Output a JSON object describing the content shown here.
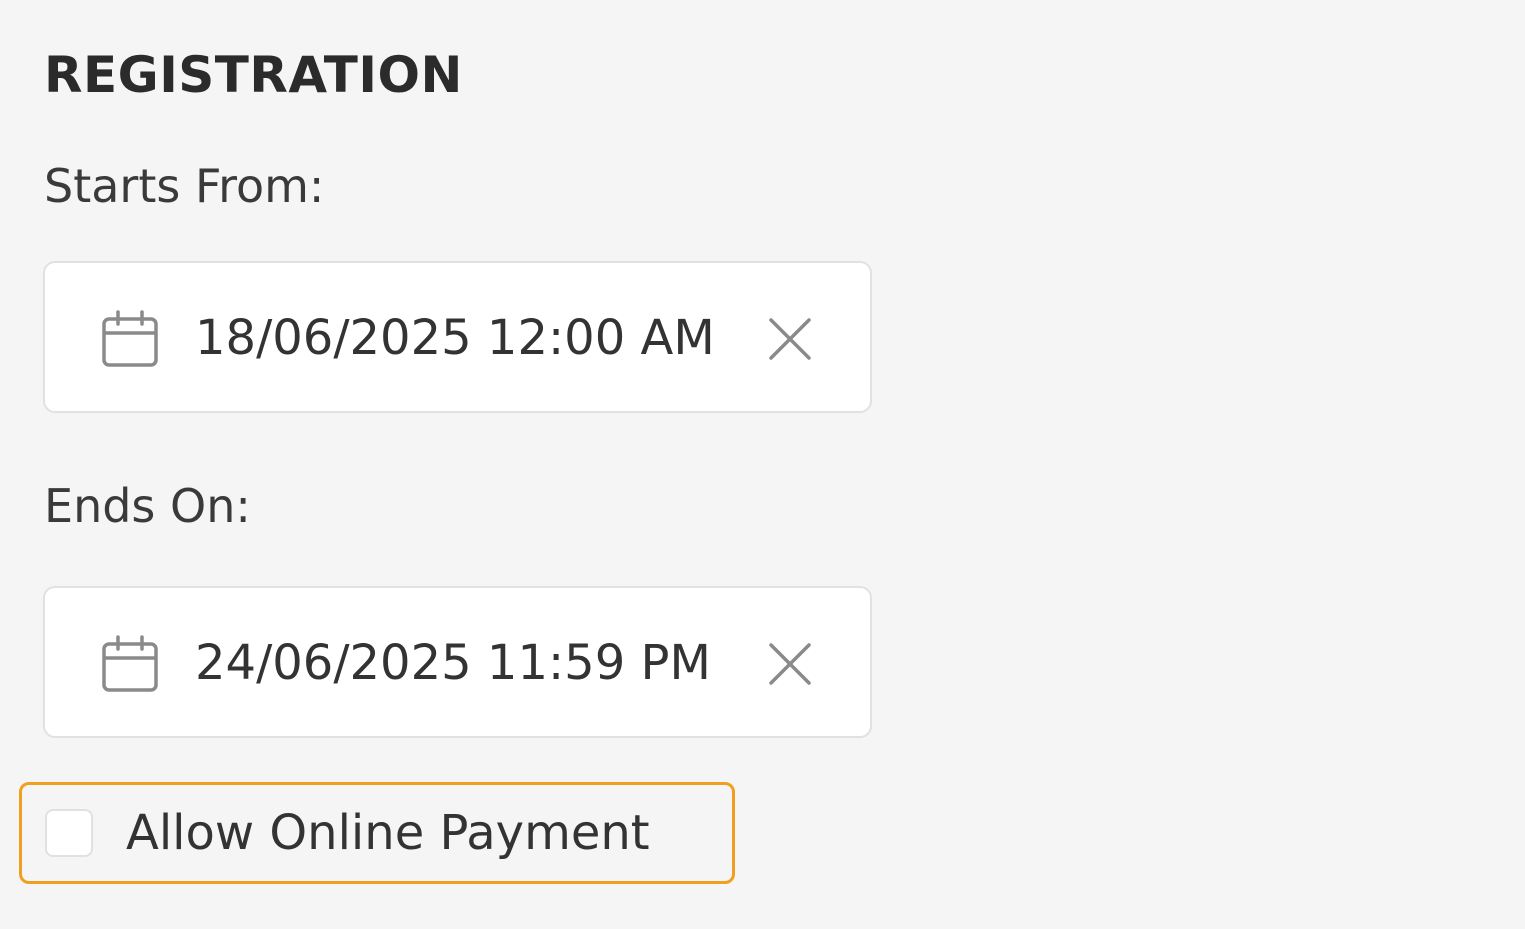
{
  "registration": {
    "title": "REGISTRATION",
    "starts_from": {
      "label": "Starts From:",
      "value": "18/06/2025 12:00 AM",
      "icon": "calendar-icon",
      "clear_icon": "close-icon"
    },
    "ends_on": {
      "label": "Ends On:",
      "value": "24/06/2025 11:59 PM",
      "icon": "calendar-icon",
      "clear_icon": "close-icon"
    },
    "allow_online_payment": {
      "label": "Allow Online Payment",
      "checked": false
    }
  },
  "colors": {
    "background": "#f5f5f5",
    "focus_outline": "#f0a020",
    "border": "#e1e1e1",
    "text": "#333333"
  }
}
